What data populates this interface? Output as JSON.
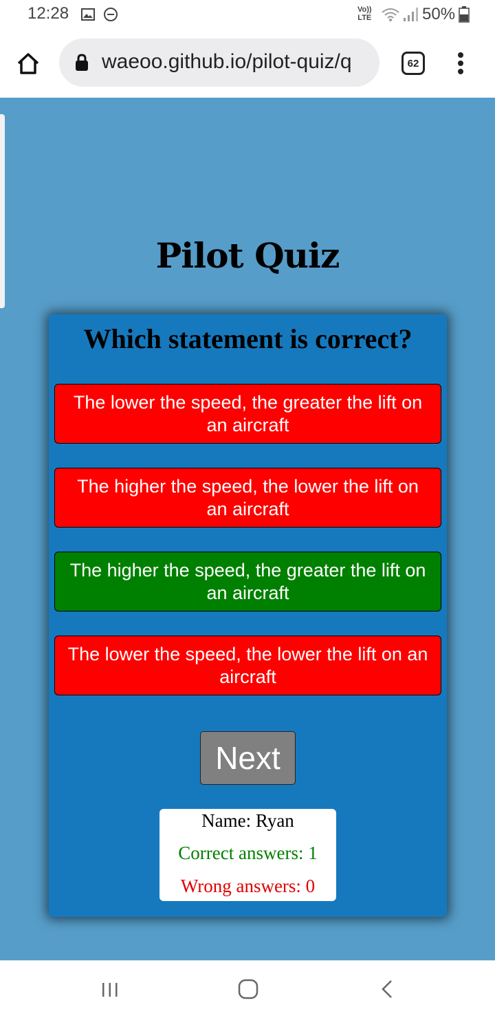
{
  "status_bar": {
    "time": "12:28",
    "volte_line1": "Vo))",
    "volte_line2": "LTE",
    "battery": "50%"
  },
  "browser": {
    "url": "waeoo.github.io/pilot-quiz/q",
    "tab_count": "62"
  },
  "page": {
    "title": "Pilot Quiz",
    "question": "Which statement is correct?",
    "answers": [
      {
        "text": "The lower the speed, the greater the lift on an aircraft",
        "state": "wrong",
        "color": "#ff0000"
      },
      {
        "text": "The higher the speed, the lower the lift on an aircraft",
        "state": "wrong",
        "color": "#ff0000"
      },
      {
        "text": "The higher the speed, the greater the lift on an aircraft",
        "state": "correct",
        "color": "#008000"
      },
      {
        "text": "The lower the speed, the lower the lift on an aircraft",
        "state": "wrong",
        "color": "#ff0000"
      }
    ],
    "next_label": "Next",
    "score": {
      "name_line": "Name: Ryan",
      "correct_line": "Correct answers: 1",
      "wrong_line": "Wrong answers: 0"
    }
  },
  "colors": {
    "page_background": "#569dc9",
    "card_background": "#1679bd"
  }
}
